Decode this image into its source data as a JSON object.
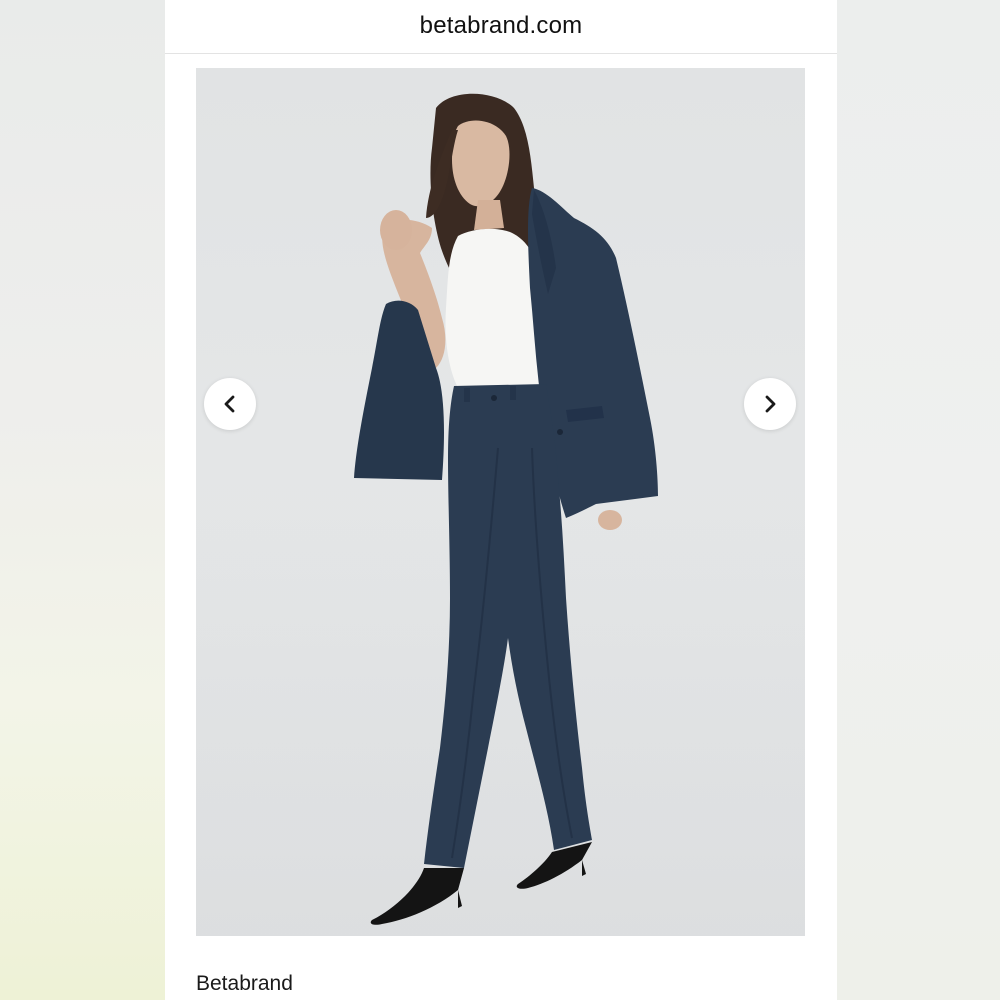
{
  "address_bar": {
    "url": "betabrand.com"
  },
  "carousel": {
    "image": "product-model-photo",
    "prev_icon": "chevron-left-icon",
    "next_icon": "chevron-right-icon"
  },
  "product": {
    "brand": "Betabrand"
  },
  "colors": {
    "navy": "#2b3c52",
    "background": "#e2e4e5",
    "white": "#ffffff"
  }
}
